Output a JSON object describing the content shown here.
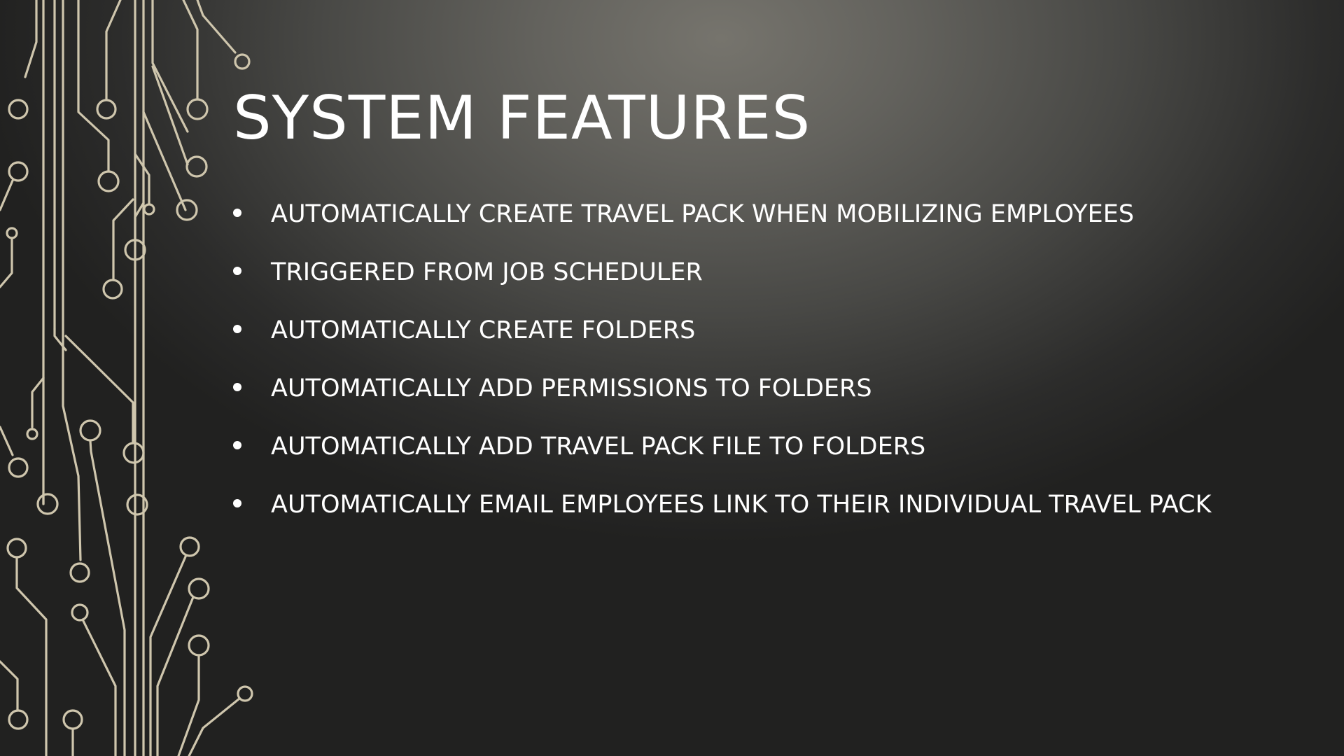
{
  "slide": {
    "title": "SYSTEM FEATURES",
    "bullets": [
      "AUTOMATICALLY CREATE TRAVEL PACK WHEN MOBILIZING EMPLOYEES",
      "TRIGGERED FROM JOB SCHEDULER",
      "AUTOMATICALLY CREATE FOLDERS",
      "AUTOMATICALLY ADD PERMISSIONS TO FOLDERS",
      "AUTOMATICALLY ADD TRAVEL PACK FILE TO FOLDERS",
      "AUTOMATICALLY EMAIL EMPLOYEES LINK TO THEIR INDIVIDUAL TRAVEL PACK"
    ],
    "bullet_icon": "bullet-dot",
    "decoration_icon": "circuit-board-decoration",
    "colors": {
      "text": "#ffffff",
      "background_light": "#76746d",
      "background_dark": "#212120",
      "circuit_lines": "#cfc6ad"
    }
  }
}
